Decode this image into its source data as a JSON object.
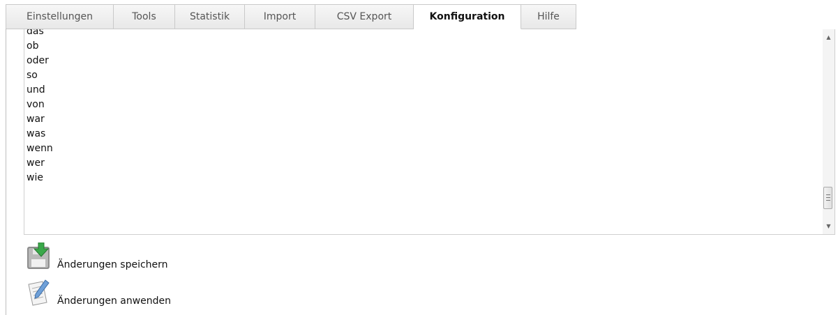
{
  "tabs": [
    {
      "label": "Einstellungen"
    },
    {
      "label": "Tools"
    },
    {
      "label": "Statistik"
    },
    {
      "label": "Import"
    },
    {
      "label": "CSV Export"
    },
    {
      "label": "Konfiguration",
      "active": true
    },
    {
      "label": "Hilfe"
    }
  ],
  "list": {
    "items": [
      "das",
      "ob",
      "oder",
      "so",
      "und",
      "von",
      "war",
      "was",
      "wenn",
      "wer",
      "wie"
    ]
  },
  "actions": {
    "save": {
      "label": "Änderungen speichern",
      "icon": "save-disk-icon"
    },
    "apply": {
      "label": "Änderungen anwenden",
      "icon": "edit-document-icon"
    }
  },
  "colors": {
    "accent_green": "#3aa84a",
    "border": "#c9c9c9"
  }
}
